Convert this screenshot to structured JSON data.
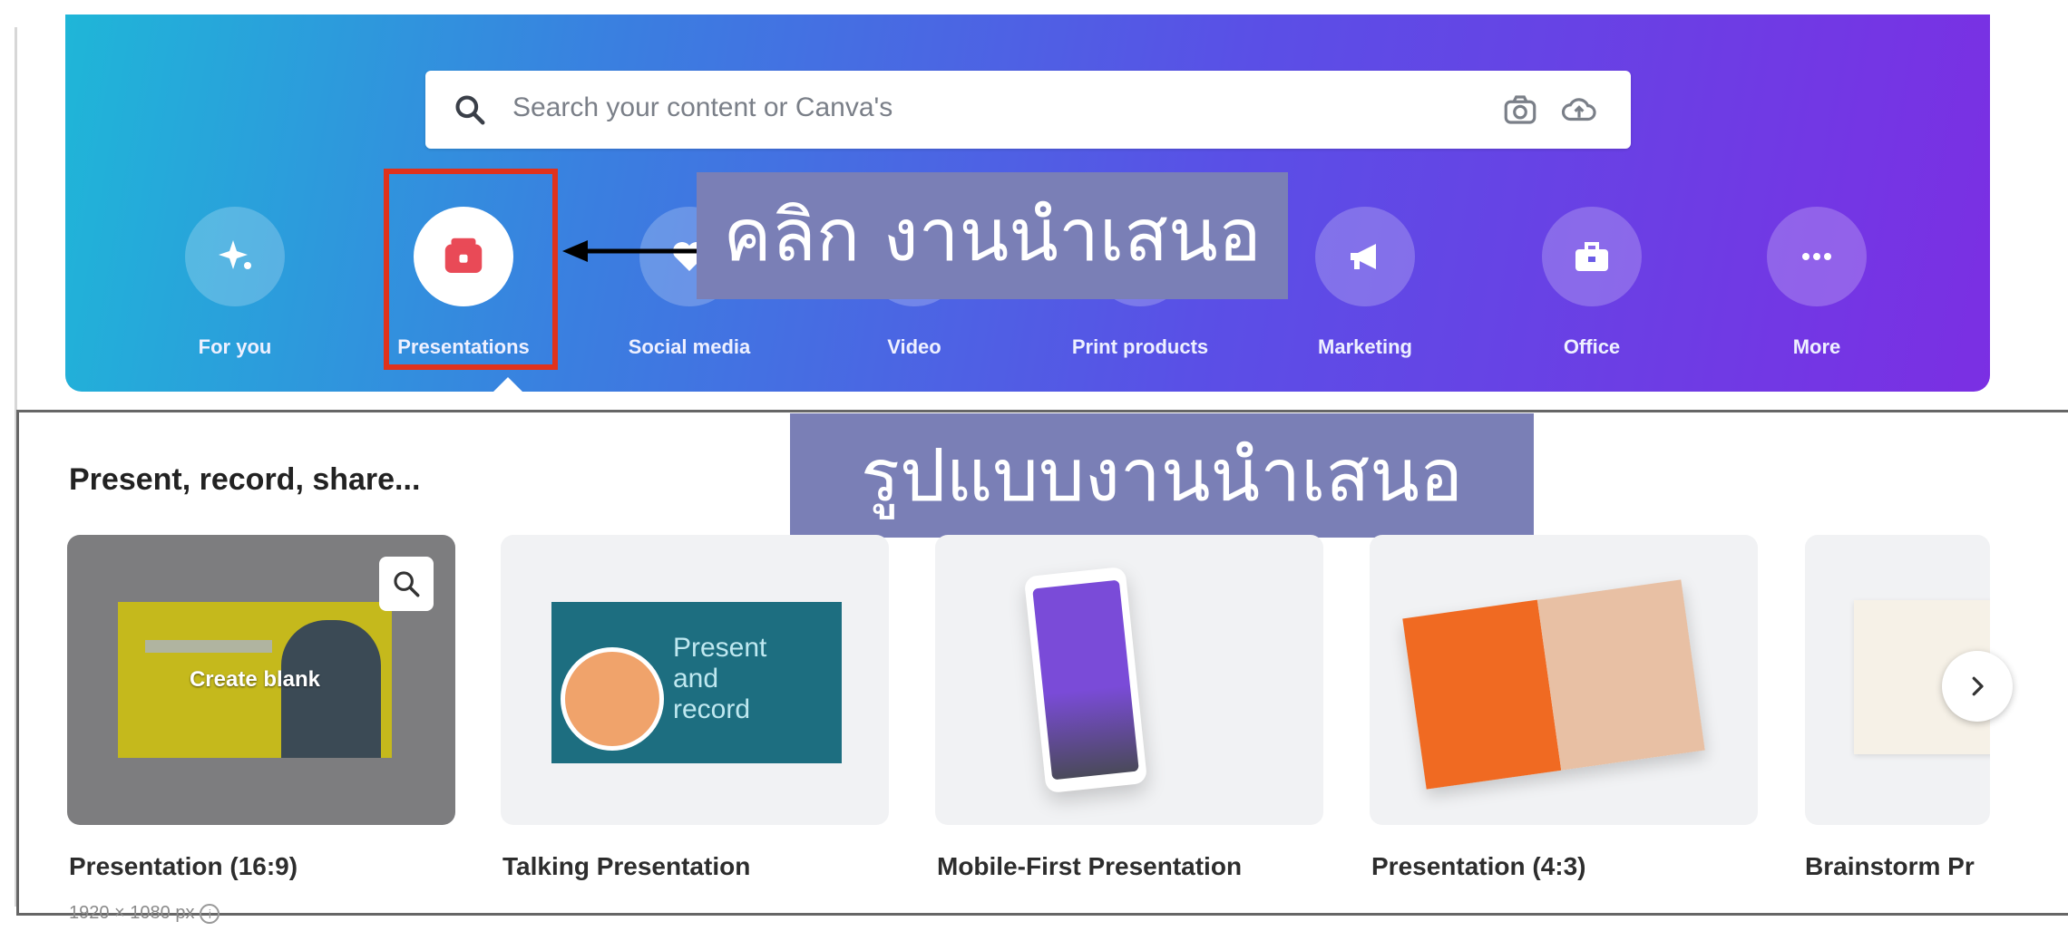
{
  "search": {
    "placeholder": "Search your content or Canva's"
  },
  "categories": [
    {
      "label": "For you",
      "icon": "sparkle-icon"
    },
    {
      "label": "Presentations",
      "icon": "presentation-icon"
    },
    {
      "label": "Social media",
      "icon": "heart-icon"
    },
    {
      "label": "Video",
      "icon": "video-icon"
    },
    {
      "label": "Print products",
      "icon": "print-icon"
    },
    {
      "label": "Marketing",
      "icon": "megaphone-icon"
    },
    {
      "label": "Office",
      "icon": "briefcase-icon"
    },
    {
      "label": "More",
      "icon": "more-icon"
    }
  ],
  "annotations": {
    "click_presentation": "คลิก งานนำเสนอ",
    "presentation_templates": "รูปแบบงานนำเสนอ"
  },
  "section": {
    "title": "Present, record, share...",
    "create_blank": "Create blank",
    "cards": [
      {
        "caption": "Presentation (16:9)",
        "subcaption": "1920 × 1080 px"
      },
      {
        "caption": "Talking Presentation",
        "thumb_text": "Present\nand\nrecord"
      },
      {
        "caption": "Mobile-First Presentation"
      },
      {
        "caption": "Presentation (4:3)"
      },
      {
        "caption": "Brainstorm Pr"
      }
    ]
  },
  "colors": {
    "highlight": "#e0321c",
    "callout_bg": "#7a7fb6",
    "gradient_start": "#1fb6d8",
    "gradient_end": "#7b2fe3"
  }
}
